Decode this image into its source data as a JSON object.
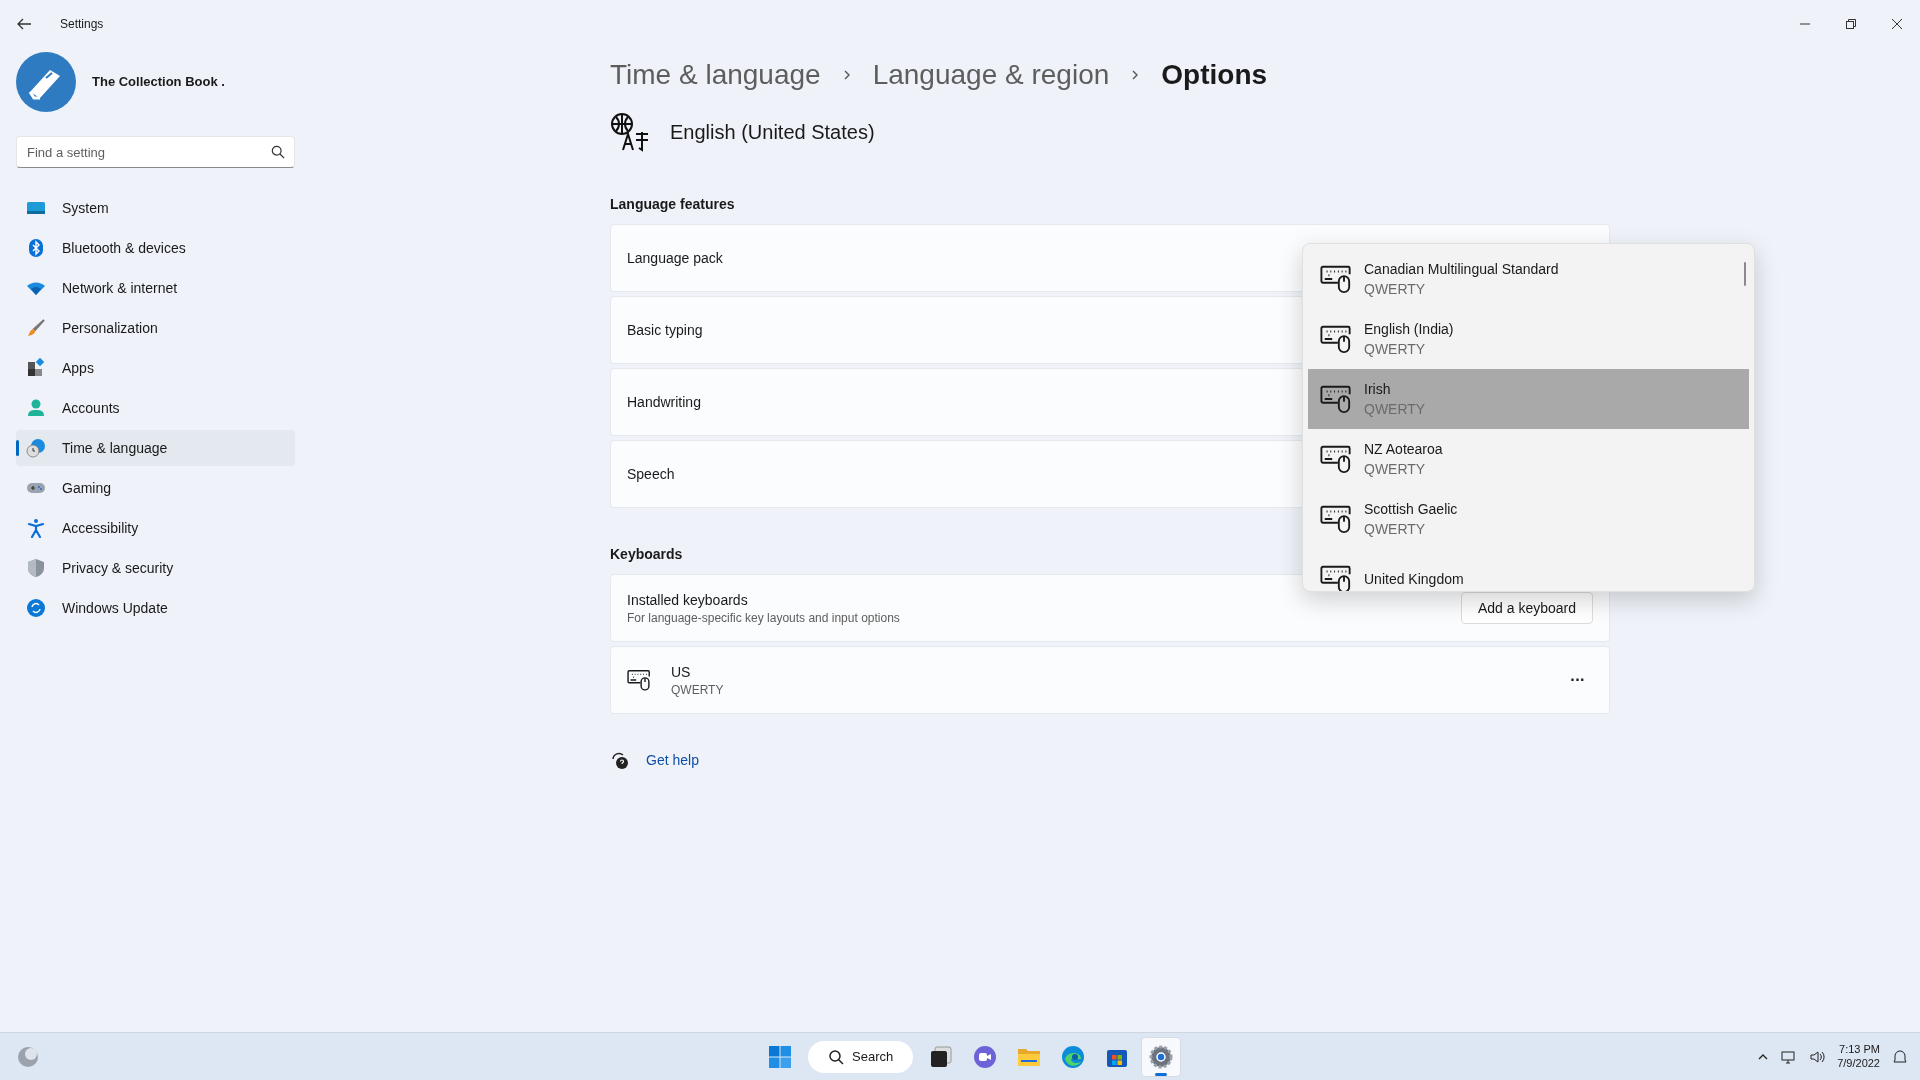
{
  "window": {
    "title": "Settings"
  },
  "profile": {
    "name": "The Collection Book ."
  },
  "search": {
    "placeholder": "Find a setting"
  },
  "nav": [
    {
      "label": "System",
      "kind": "system",
      "selected": false
    },
    {
      "label": "Bluetooth & devices",
      "kind": "bluetooth",
      "selected": false
    },
    {
      "label": "Network & internet",
      "kind": "network",
      "selected": false
    },
    {
      "label": "Personalization",
      "kind": "brush",
      "selected": false
    },
    {
      "label": "Apps",
      "kind": "apps",
      "selected": false
    },
    {
      "label": "Accounts",
      "kind": "accounts",
      "selected": false
    },
    {
      "label": "Time & language",
      "kind": "time",
      "selected": true
    },
    {
      "label": "Gaming",
      "kind": "gaming",
      "selected": false
    },
    {
      "label": "Accessibility",
      "kind": "accessibility",
      "selected": false
    },
    {
      "label": "Privacy & security",
      "kind": "privacy",
      "selected": false
    },
    {
      "label": "Windows Update",
      "kind": "update",
      "selected": false
    }
  ],
  "breadcrumb": [
    {
      "label": "Time & language",
      "current": false
    },
    {
      "label": "Language & region",
      "current": false
    },
    {
      "label": "Options",
      "current": true
    }
  ],
  "language": {
    "name": "English (United States)"
  },
  "language_features": {
    "title": "Language features",
    "rows": [
      {
        "label": "Language pack"
      },
      {
        "label": "Basic typing"
      },
      {
        "label": "Handwriting"
      },
      {
        "label": "Speech"
      }
    ]
  },
  "keyboards": {
    "title": "Keyboards",
    "installed": {
      "title": "Installed keyboards",
      "subtitle": "For language-specific key layouts and input options",
      "button": "Add a keyboard"
    },
    "items": [
      {
        "name": "US",
        "layout": "QWERTY",
        "more": "···"
      }
    ]
  },
  "get_help": "Get help",
  "dropdown": {
    "items": [
      {
        "name": "Canadian Multilingual Standard",
        "layout": "QWERTY",
        "selected": false
      },
      {
        "name": "English (India)",
        "layout": "QWERTY",
        "selected": false
      },
      {
        "name": "Irish",
        "layout": "QWERTY",
        "selected": true
      },
      {
        "name": "NZ Aotearoa",
        "layout": "QWERTY",
        "selected": false
      },
      {
        "name": "Scottish Gaelic",
        "layout": "QWERTY",
        "selected": false
      },
      {
        "name": "United Kingdom",
        "selected": false
      }
    ]
  },
  "taskbar": {
    "search": "Search",
    "apps": [
      {
        "kind": "start",
        "active": false
      },
      {
        "kind": "taskview",
        "active": false
      },
      {
        "kind": "chat",
        "active": false
      },
      {
        "kind": "explorer",
        "active": false
      },
      {
        "kind": "edge",
        "active": false
      },
      {
        "kind": "store",
        "active": false
      },
      {
        "kind": "settings",
        "active": true
      }
    ],
    "clock": {
      "time": "7:13 PM",
      "date": "7/9/2022"
    }
  }
}
